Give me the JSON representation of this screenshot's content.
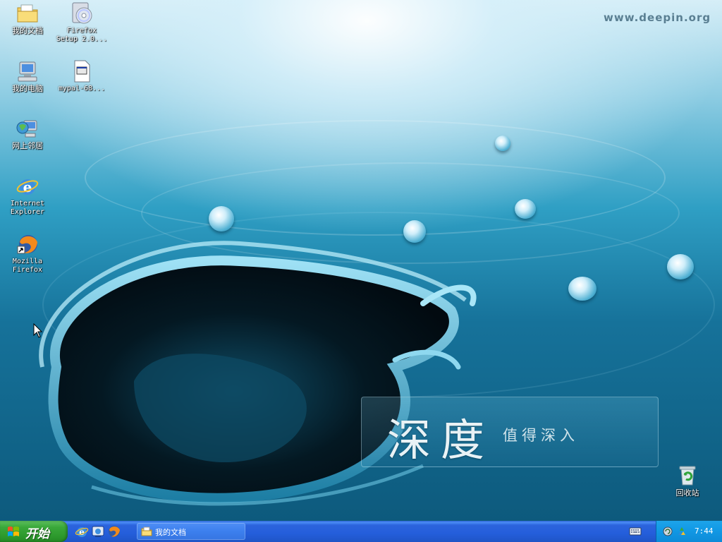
{
  "watermark": "www.deepin.org",
  "brand": {
    "title": "深度",
    "slogan": "值得深入"
  },
  "desktop_icons": [
    {
      "label": "我的文档",
      "icon": "my-documents-folder-icon"
    },
    {
      "label": "Firefox\nSetup 2.0...",
      "icon": "firefox-installer-cd-icon"
    },
    {
      "label": "我的电脑",
      "icon": "my-computer-icon"
    },
    {
      "label": "mypal-68...",
      "icon": "executable-file-icon"
    },
    {
      "label": "网上邻居",
      "icon": "network-places-icon"
    },
    {
      "label": "Internet\nExplorer",
      "icon": "internet-explorer-icon"
    },
    {
      "label": "Mozilla\nFirefox",
      "icon": "firefox-icon"
    },
    {
      "label": "回收站",
      "icon": "recycle-bin-icon"
    }
  ],
  "taskbar": {
    "start_label": "开始",
    "quick_launch": [
      "internet-explorer-icon",
      "show-desktop-icon",
      "firefox-icon"
    ],
    "tasks": [
      {
        "label": "我的文档",
        "icon": "folder-icon"
      }
    ],
    "tray_icons": [
      "keyboard-ime-icon",
      "network-tray-icon",
      "recycle-tray-icon"
    ],
    "clock": "7:44"
  },
  "colors": {
    "taskbar": "#245edb",
    "start_button": "#3aa83a",
    "tray": "#129ae6"
  }
}
